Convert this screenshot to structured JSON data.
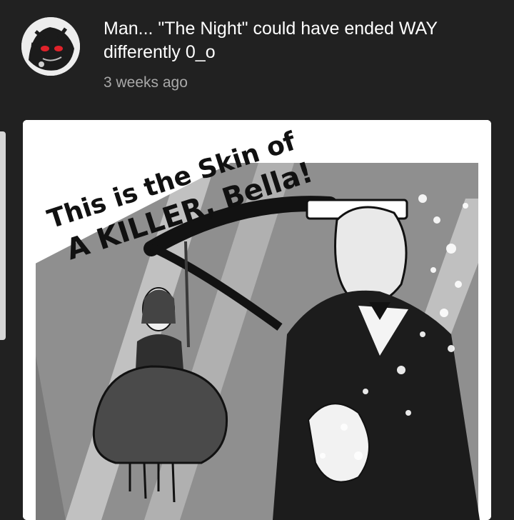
{
  "post": {
    "text_line1": "Man... \"The Night\" could have ended WAY",
    "text_line2": "differently 0_o",
    "timestamp": "3 weeks ago"
  },
  "image": {
    "caption_small": "the Skin of",
    "caption_line1": "This is",
    "caption_line2": "A KILLER, Bella!"
  },
  "icons": {
    "avatar": "avatar-icon"
  }
}
